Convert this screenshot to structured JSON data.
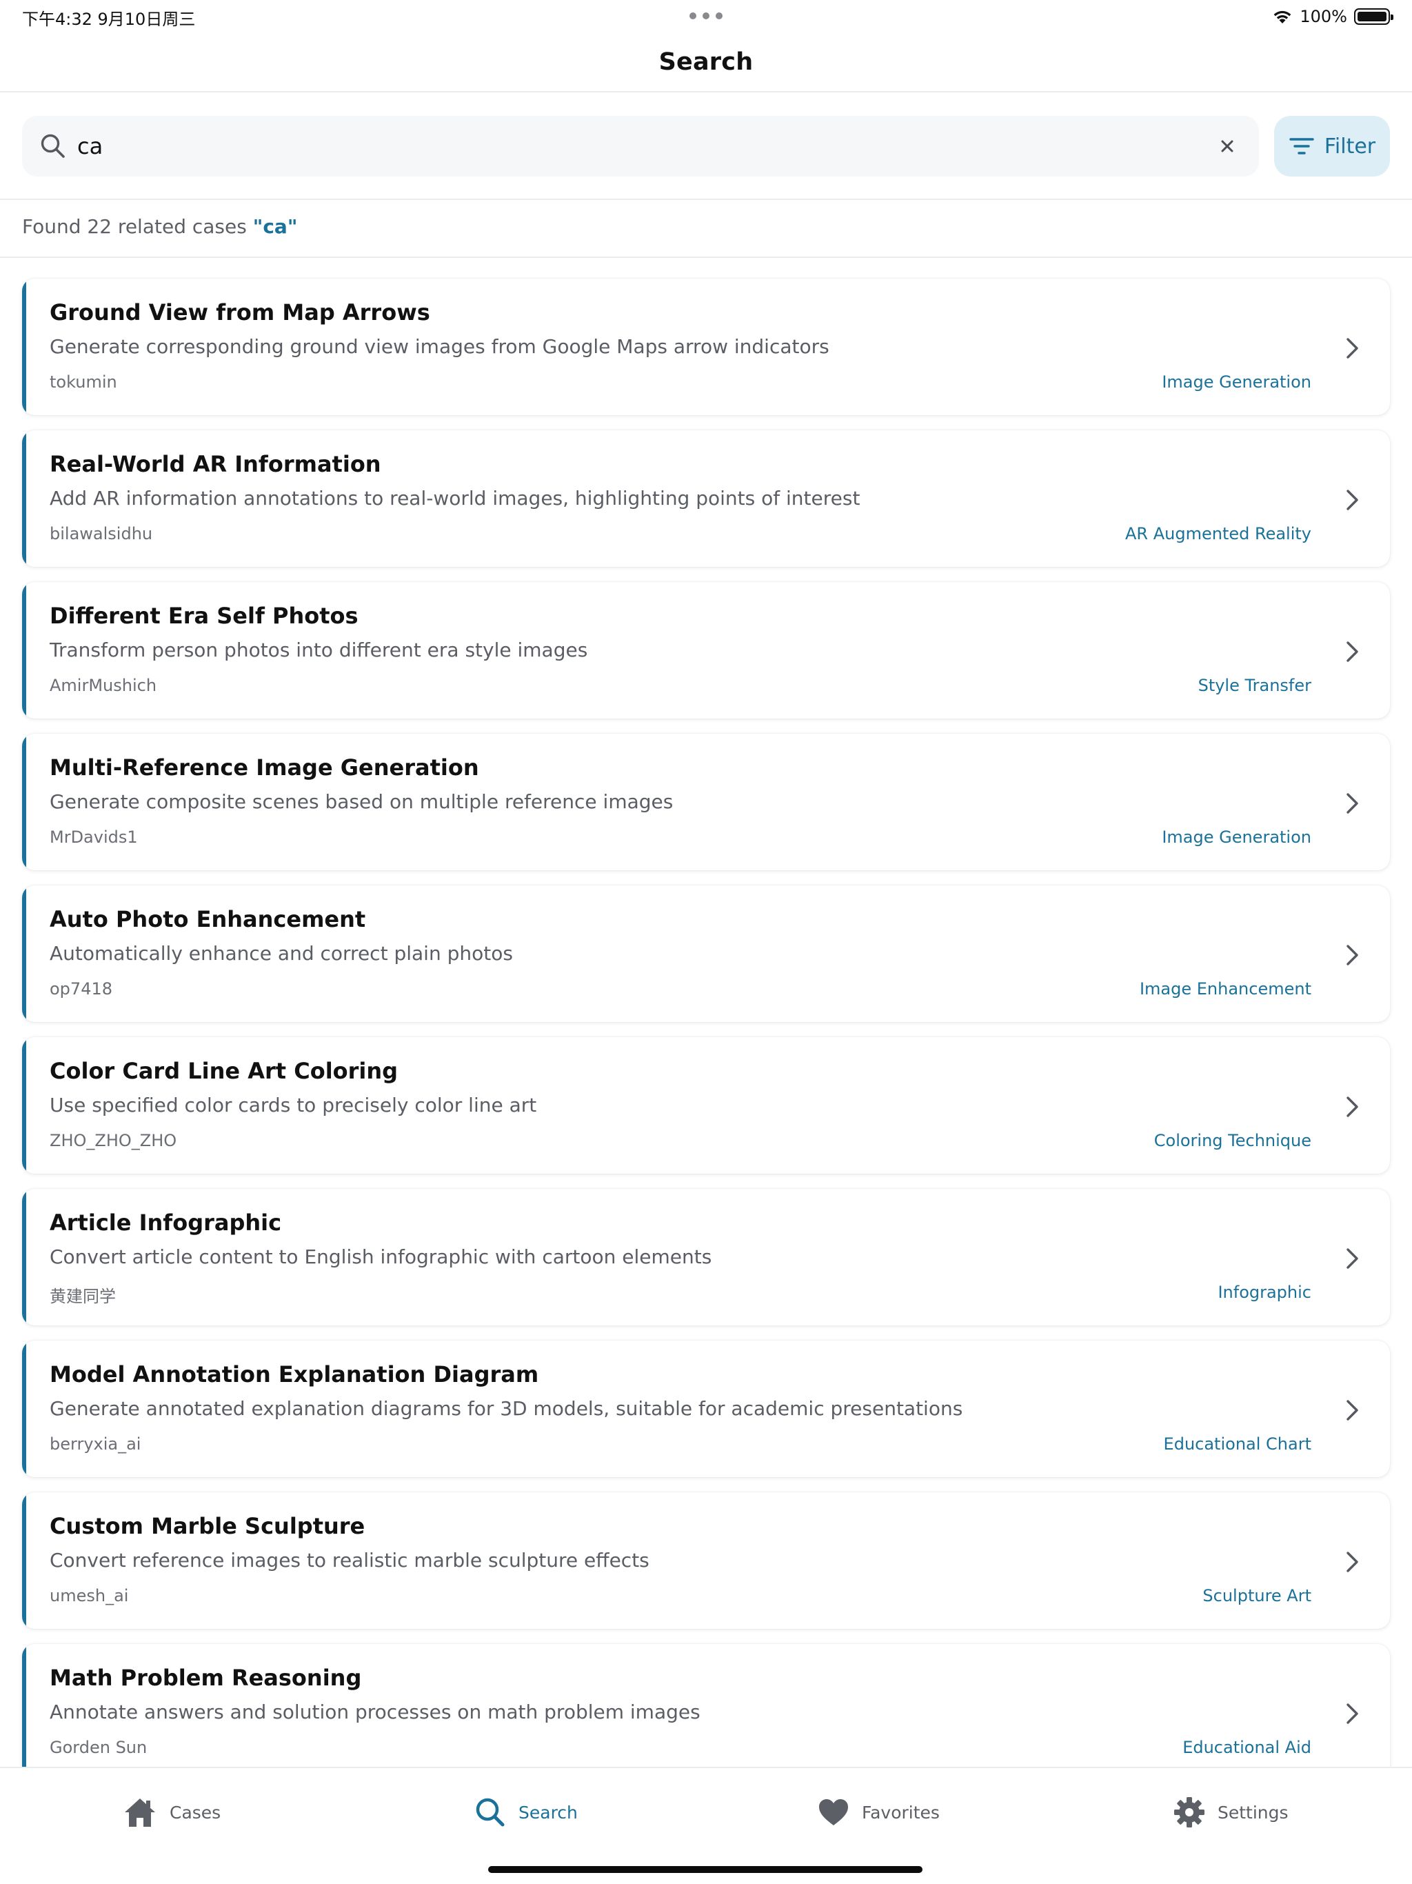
{
  "status_bar": {
    "time": "下午4:32   9月10日周三",
    "battery_percent": "100%",
    "battery_level": 1.0
  },
  "nav": {
    "title": "Search"
  },
  "search": {
    "value": "ca",
    "clear_icon": "close-icon",
    "search_icon": "search-icon"
  },
  "filter": {
    "label": "Filter",
    "icon": "filter-lines-icon"
  },
  "summary": {
    "prefix": "Found 22 related cases ",
    "query": "\"ca\""
  },
  "results": [
    {
      "title": "Ground View from Map Arrows",
      "description": "Generate corresponding ground view images from Google Maps arrow indicators",
      "author": "tokumin",
      "tag": "Image Generation"
    },
    {
      "title": "Real-World AR Information",
      "description": "Add AR information annotations to real-world images, highlighting points of interest",
      "author": "bilawalsidhu",
      "tag": "AR Augmented Reality"
    },
    {
      "title": "Different Era Self Photos",
      "description": "Transform person photos into different era style images",
      "author": "AmirMushich",
      "tag": "Style Transfer"
    },
    {
      "title": "Multi-Reference Image Generation",
      "description": "Generate composite scenes based on multiple reference images",
      "author": "MrDavids1",
      "tag": "Image Generation"
    },
    {
      "title": "Auto Photo Enhancement",
      "description": "Automatically enhance and correct plain photos",
      "author": "op7418",
      "tag": "Image Enhancement"
    },
    {
      "title": "Color Card Line Art Coloring",
      "description": "Use specified color cards to precisely color line art",
      "author": "ZHO_ZHO_ZHO",
      "tag": "Coloring Technique"
    },
    {
      "title": "Article Infographic",
      "description": "Convert article content to English infographic with cartoon elements",
      "author": "黄建同学",
      "tag": "Infographic"
    },
    {
      "title": "Model Annotation Explanation Diagram",
      "description": "Generate annotated explanation diagrams for 3D models, suitable for academic presentations",
      "author": "berryxia_ai",
      "tag": "Educational Chart"
    },
    {
      "title": "Custom Marble Sculpture",
      "description": "Convert reference images to realistic marble sculpture effects",
      "author": "umesh_ai",
      "tag": "Sculpture Art"
    },
    {
      "title": "Math Problem Reasoning",
      "description": "Annotate answers and solution processes on math problem images",
      "author": "Gorden Sun",
      "tag": "Educational Aid"
    }
  ],
  "tabs": [
    {
      "label": "Cases",
      "icon": "home-icon",
      "active": false
    },
    {
      "label": "Search",
      "icon": "search-icon",
      "active": true
    },
    {
      "label": "Favorites",
      "icon": "heart-icon",
      "active": false
    },
    {
      "label": "Settings",
      "icon": "gear-icon",
      "active": false
    }
  ],
  "colors": {
    "accent": "#1a7199",
    "filter_bg": "#deeef6",
    "search_bg": "#f6f7f8",
    "inactive": "#5c5f66"
  }
}
